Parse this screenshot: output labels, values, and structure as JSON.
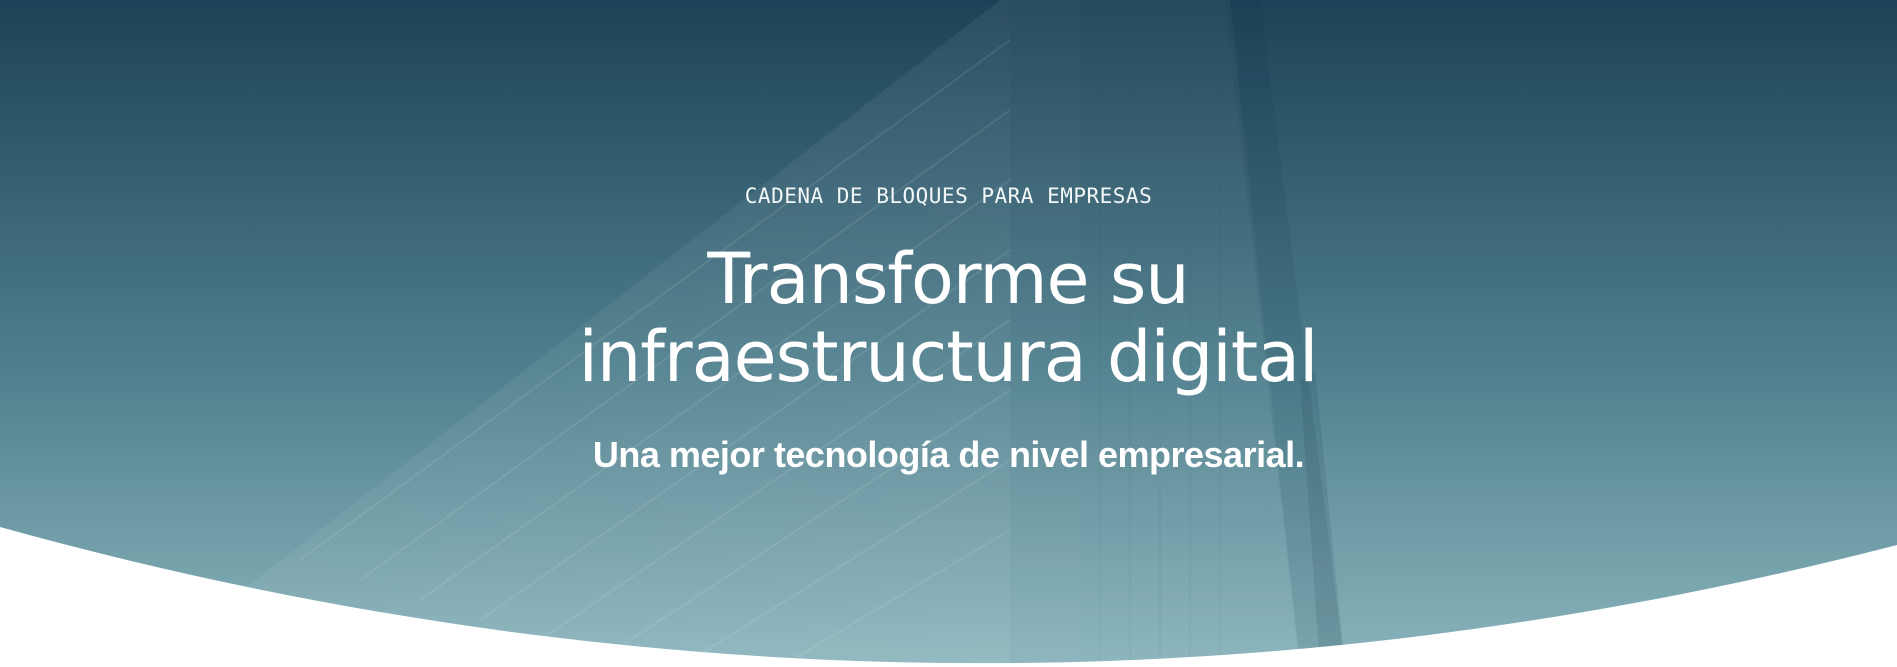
{
  "hero": {
    "eyebrow": "CADENA DE BLOQUES PARA EMPRESAS",
    "title": "Transforme su infraestructura digital",
    "subtitle": "Una mejor tecnología de nivel empresarial.",
    "background_image": "glass-skyscraper-photo",
    "colors": {
      "gradient_top": "#1d4257",
      "gradient_bottom": "#8ab4bc",
      "text": "#ffffff",
      "page_background": "#ffffff"
    }
  }
}
